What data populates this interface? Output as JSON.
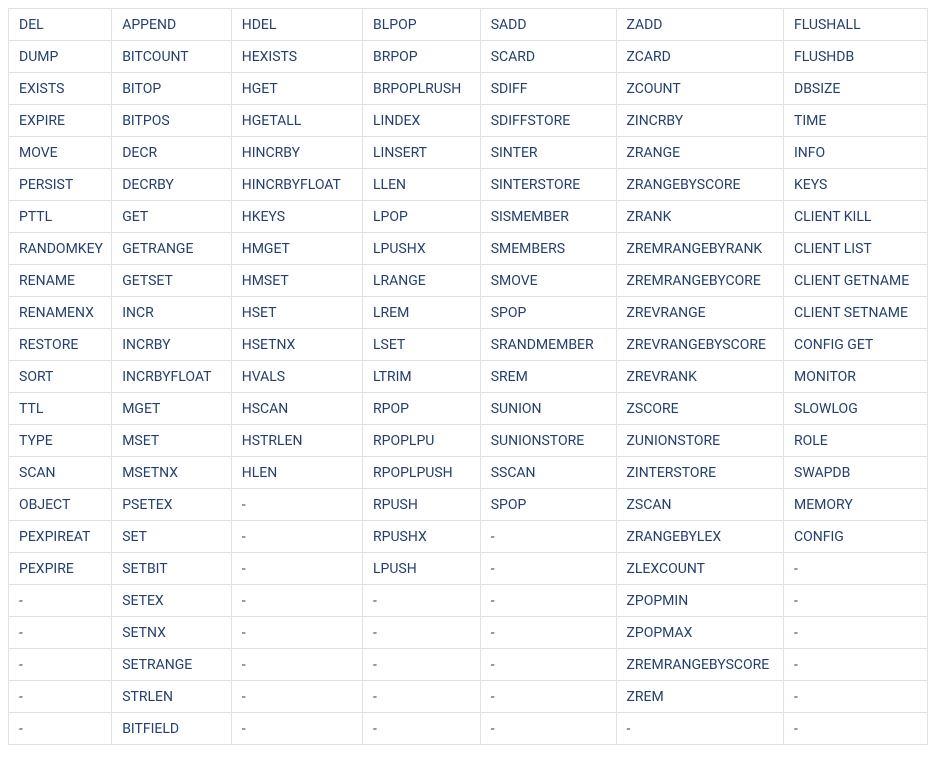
{
  "table": {
    "rows": [
      [
        "DEL",
        "APPEND",
        "HDEL",
        "BLPOP",
        "SADD",
        "ZADD",
        "FLUSHALL"
      ],
      [
        "DUMP",
        "BITCOUNT",
        "HEXISTS",
        "BRPOP",
        "SCARD",
        "ZCARD",
        "FLUSHDB"
      ],
      [
        "EXISTS",
        "BITOP",
        "HGET",
        "BRPOPLRUSH",
        "SDIFF",
        "ZCOUNT",
        "DBSIZE"
      ],
      [
        "EXPIRE",
        "BITPOS",
        "HGETALL",
        "LINDEX",
        "SDIFFSTORE",
        "ZINCRBY",
        "TIME"
      ],
      [
        "MOVE",
        "DECR",
        "HINCRBY",
        "LINSERT",
        "SINTER",
        "ZRANGE",
        "INFO"
      ],
      [
        "PERSIST",
        "DECRBY",
        "HINCRBYFLOAT",
        "LLEN",
        "SINTERSTORE",
        "ZRANGEBYSCORE",
        "KEYS"
      ],
      [
        "PTTL",
        "GET",
        "HKEYS",
        "LPOP",
        "SISMEMBER",
        "ZRANK",
        "CLIENT KILL"
      ],
      [
        "RANDOMKEY",
        "GETRANGE",
        "HMGET",
        "LPUSHX",
        "SMEMBERS",
        "ZREMRANGEBYRANK",
        "CLIENT LIST"
      ],
      [
        "RENAME",
        "GETSET",
        "HMSET",
        "LRANGE",
        "SMOVE",
        "ZREMRANGEBYCORE",
        "CLIENT GETNAME"
      ],
      [
        "RENAMENX",
        "INCR",
        "HSET",
        "LREM",
        "SPOP",
        "ZREVRANGE",
        "CLIENT SETNAME"
      ],
      [
        "RESTORE",
        "INCRBY",
        "HSETNX",
        "LSET",
        "SRANDMEMBER",
        "ZREVRANGEBYSCORE",
        "CONFIG GET"
      ],
      [
        "SORT",
        "INCRBYFLOAT",
        "HVALS",
        "LTRIM",
        "SREM",
        "ZREVRANK",
        "MONITOR"
      ],
      [
        "TTL",
        "MGET",
        "HSCAN",
        "RPOP",
        "SUNION",
        "ZSCORE",
        "SLOWLOG"
      ],
      [
        "TYPE",
        "MSET",
        "HSTRLEN",
        "RPOPLPU",
        "SUNIONSTORE",
        "ZUNIONSTORE",
        "ROLE"
      ],
      [
        "SCAN",
        "MSETNX",
        "HLEN",
        "RPOPLPUSH",
        "SSCAN",
        "ZINTERSTORE",
        "SWAPDB"
      ],
      [
        "OBJECT",
        "PSETEX",
        "-",
        "RPUSH",
        "SPOP",
        "ZSCAN",
        "MEMORY"
      ],
      [
        "PEXPIREAT",
        "SET",
        "-",
        "RPUSHX",
        "-",
        "ZRANGEBYLEX",
        "CONFIG"
      ],
      [
        "PEXPIRE",
        "SETBIT",
        "-",
        "LPUSH",
        "-",
        "ZLEXCOUNT",
        "-"
      ],
      [
        "-",
        "SETEX",
        "-",
        "-",
        "-",
        "ZPOPMIN",
        "-"
      ],
      [
        "-",
        "SETNX",
        "-",
        "-",
        "-",
        "ZPOPMAX",
        "-"
      ],
      [
        "-",
        "SETRANGE",
        "-",
        "-",
        "-",
        "ZREMRANGEBYSCORE",
        "-"
      ],
      [
        "-",
        "STRLEN",
        "-",
        "-",
        "-",
        "ZREM",
        "-"
      ],
      [
        "-",
        "BITFIELD",
        "-",
        "-",
        "-",
        "-",
        "-"
      ]
    ],
    "column_widths": [
      "11.4%",
      "13.2%",
      "14.5%",
      "13.0%",
      "15.0%",
      "18.5%",
      "15.9%"
    ]
  }
}
